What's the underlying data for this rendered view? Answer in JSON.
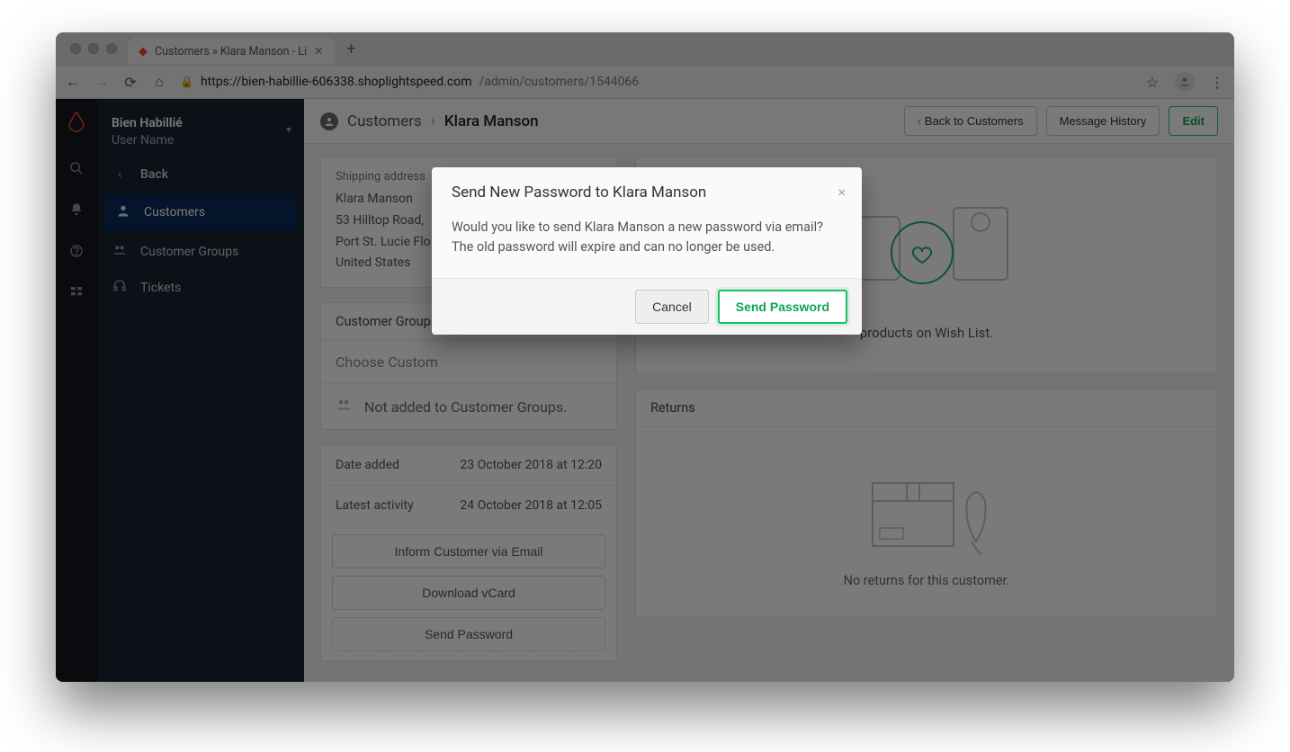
{
  "browser": {
    "tab_title": "Customers » Klara Manson - Li",
    "url_host": "https://bien-habillie-606338.shoplightspeed.com",
    "url_path": "/admin/customers/1544066"
  },
  "sidebar": {
    "org_name": "Bien Habillié",
    "user_line": "User Name",
    "back_label": "Back",
    "items": [
      {
        "label": "Customers"
      },
      {
        "label": "Customer Groups"
      },
      {
        "label": "Tickets"
      }
    ]
  },
  "header": {
    "breadcrumb_root": "Customers",
    "breadcrumb_current": "Klara Manson",
    "back_button": "Back to Customers",
    "message_history": "Message History",
    "edit": "Edit"
  },
  "shipping": {
    "label": "Shipping address",
    "name": "Klara Manson",
    "line1": "53 Hilltop Road,",
    "line2": "Port St. Lucie Flo",
    "country": "United States"
  },
  "groups": {
    "title": "Customer Groups",
    "choose": "Choose Custom",
    "none": "Not added to Customer Groups."
  },
  "meta": {
    "date_added_label": "Date added",
    "date_added_value": "23 October 2018 at 12:20",
    "latest_label": "Latest activity",
    "latest_value": "24 October 2018 at 12:05"
  },
  "actions": {
    "inform": "Inform Customer via Email",
    "vcard": "Download vCard",
    "sendpw": "Send Password"
  },
  "wishlist": {
    "empty": "products on Wish List."
  },
  "returns": {
    "title": "Returns",
    "empty": "No returns for this customer."
  },
  "modal": {
    "title": "Send New Password to Klara Manson",
    "body": "Would you like to send Klara Manson a new password via email? The old password will expire and can no longer be used.",
    "cancel": "Cancel",
    "confirm": "Send Password"
  }
}
